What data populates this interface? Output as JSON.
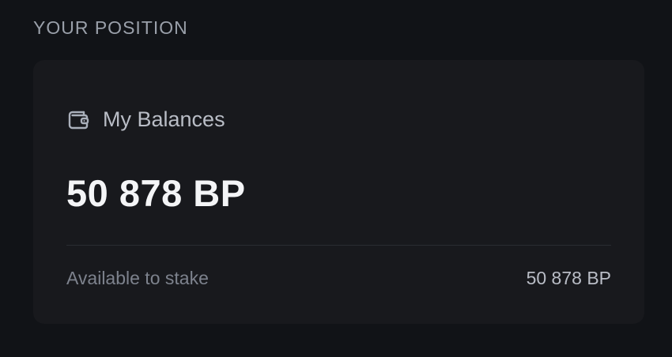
{
  "section": {
    "title": "YOUR POSITION"
  },
  "card": {
    "icon": "wallet-icon",
    "title": "My Balances",
    "balance": "50 878 BP",
    "available_label": "Available to stake",
    "available_value": "50 878 BP"
  },
  "colors": {
    "background": "#111317",
    "card": "#18191d",
    "primary_text": "#f4f5f7",
    "secondary_text": "#b9bdc6",
    "muted_text": "#7d828d"
  }
}
